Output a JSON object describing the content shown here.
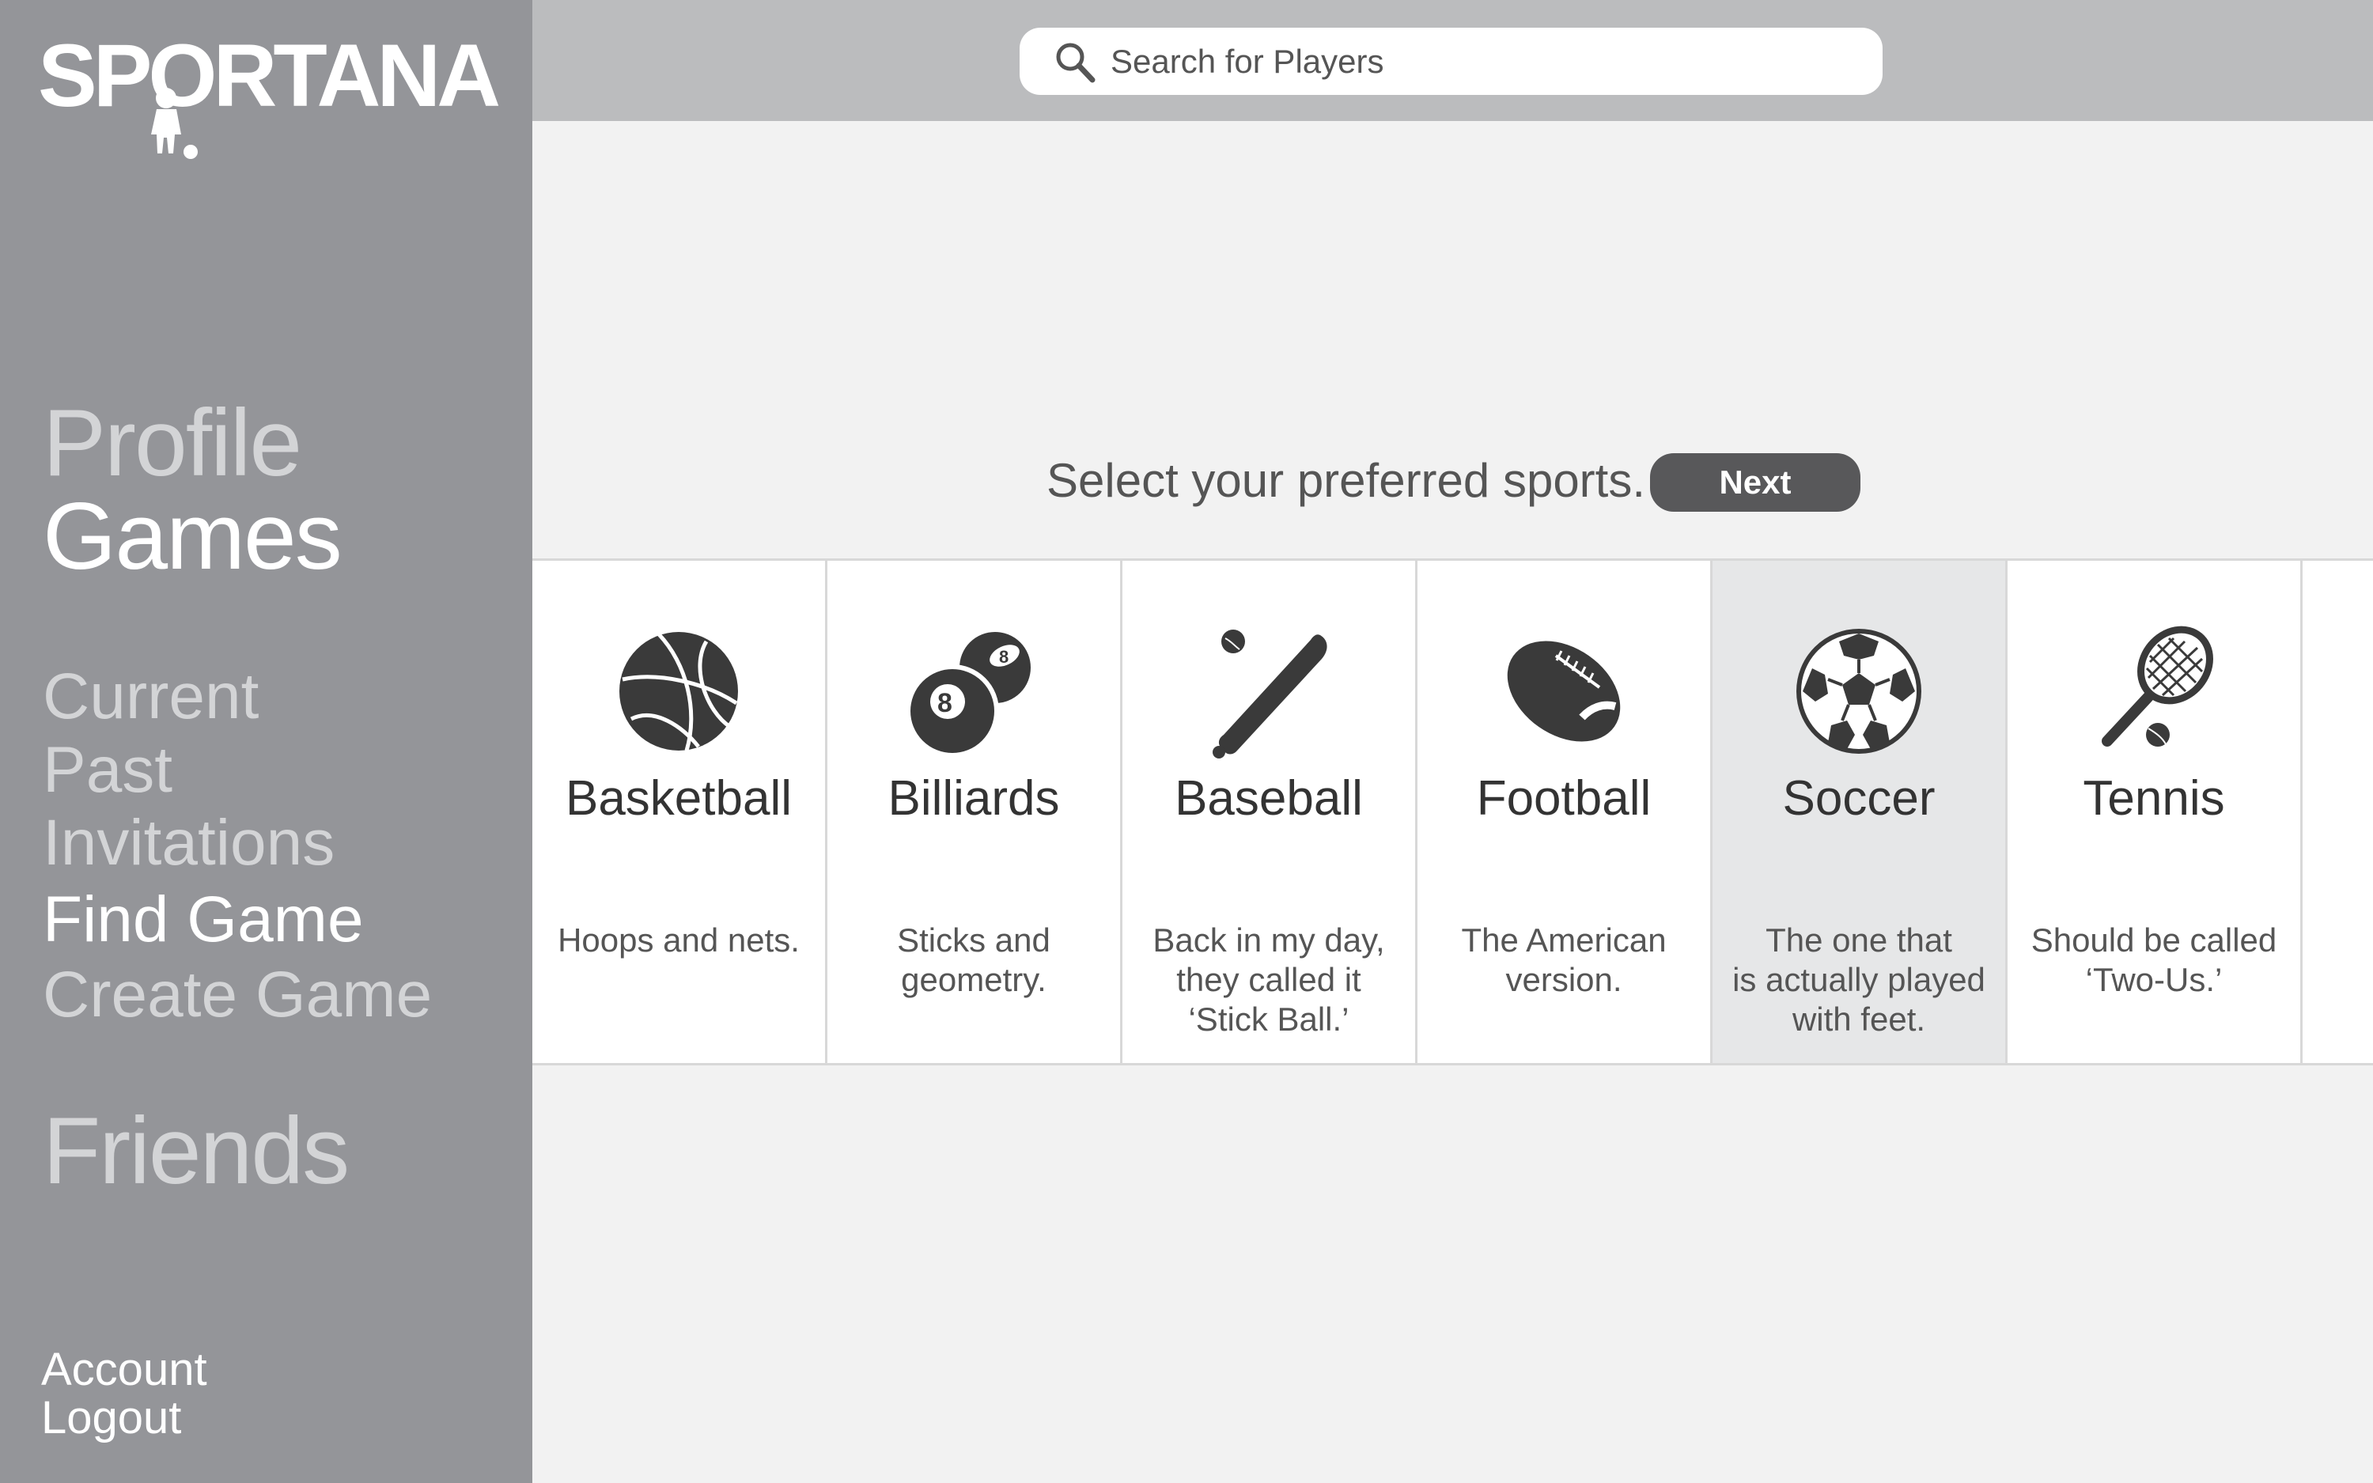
{
  "app": {
    "logo_text": "SPORTANA"
  },
  "search": {
    "placeholder": "Search for Players"
  },
  "sidebar": {
    "profile": "Profile",
    "games": "Games",
    "current": "Current",
    "past": "Past",
    "invitations": "Invitations",
    "find_game": "Find Game",
    "create_game": "Create Game",
    "friends": "Friends",
    "account": "Account",
    "logout": "Logout"
  },
  "main": {
    "prompt": "Select your preferred sports.",
    "next_label": "Next",
    "sports": [
      {
        "name": "Basketball",
        "desc": "Hoops and nets.",
        "icon": "basketball-icon",
        "selected": false
      },
      {
        "name": "Billiards",
        "desc": "Sticks and\ngeometry.",
        "icon": "billiard-balls-icon",
        "selected": false
      },
      {
        "name": "Baseball",
        "desc": "Back in my day,\nthey called it\n‘Stick Ball.’",
        "icon": "baseball-bat-icon",
        "selected": false
      },
      {
        "name": "Football",
        "desc": "The American\nversion.",
        "icon": "football-icon",
        "selected": false
      },
      {
        "name": "Soccer",
        "desc": "The one that\nis actually played\nwith feet.",
        "icon": "soccer-ball-icon",
        "selected": true
      },
      {
        "name": "Tennis",
        "desc": "Should be called\n‘Two-Us.’",
        "icon": "tennis-racket-icon",
        "selected": false
      }
    ]
  },
  "colors": {
    "sidebar_bg": "#949599",
    "topbar_bg": "#bbbcbe",
    "content_bg": "#f2f2f2",
    "selected_card_bg": "#e6e7e8",
    "button_bg": "#58585a"
  }
}
